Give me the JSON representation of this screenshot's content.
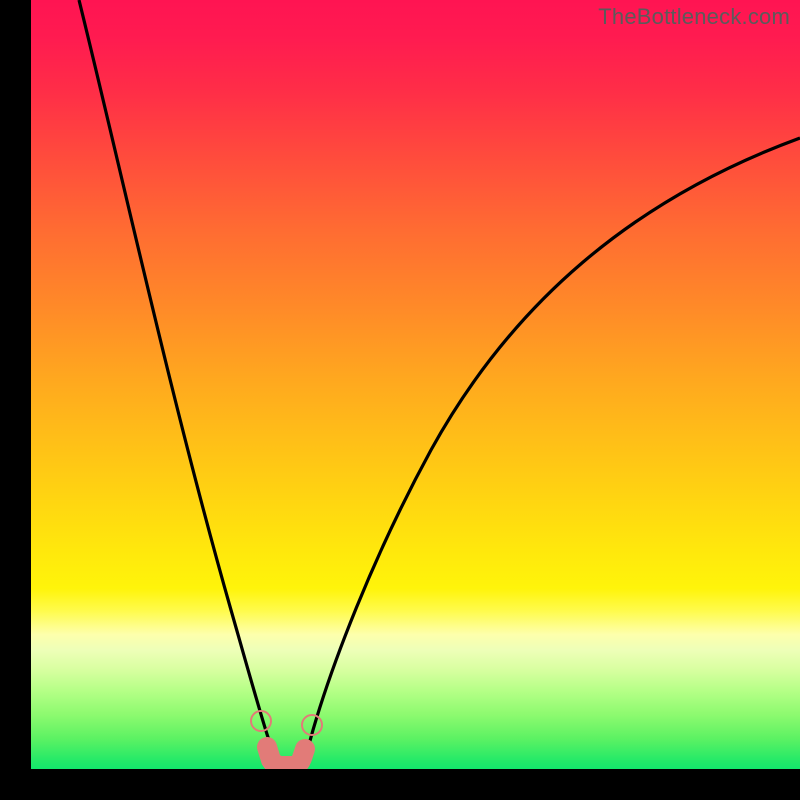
{
  "watermark": {
    "text": "TheBottleneck.com"
  },
  "colors": {
    "curve_stroke": "#000000",
    "marker_fill": "#e27b78",
    "background": "#000000"
  },
  "chart_data": {
    "type": "line",
    "title": "",
    "xlabel": "",
    "ylabel": "",
    "xlim": [
      0,
      100
    ],
    "ylim": [
      0,
      100
    ],
    "grid": false,
    "legend": false,
    "note": "Bottleneck curve; y ≈ percentage bottleneck, x ≈ relative component performance. Values estimated from pixels.",
    "series": [
      {
        "name": "bottleneck-curve",
        "x": [
          6,
          12,
          18,
          23,
          27,
          30,
          32,
          34,
          37,
          40,
          45,
          52,
          60,
          70,
          82,
          95,
          100
        ],
        "y": [
          100,
          75,
          50,
          30,
          14,
          4,
          0,
          0,
          4,
          14,
          30,
          46,
          58,
          70,
          80,
          88,
          90
        ]
      }
    ],
    "markers": {
      "name": "sweet-spot",
      "points": [
        {
          "x": 30,
          "y": 4
        },
        {
          "x": 31,
          "y": 0.2
        },
        {
          "x": 34,
          "y": 0.2
        },
        {
          "x": 35.5,
          "y": 3.5
        }
      ]
    }
  }
}
